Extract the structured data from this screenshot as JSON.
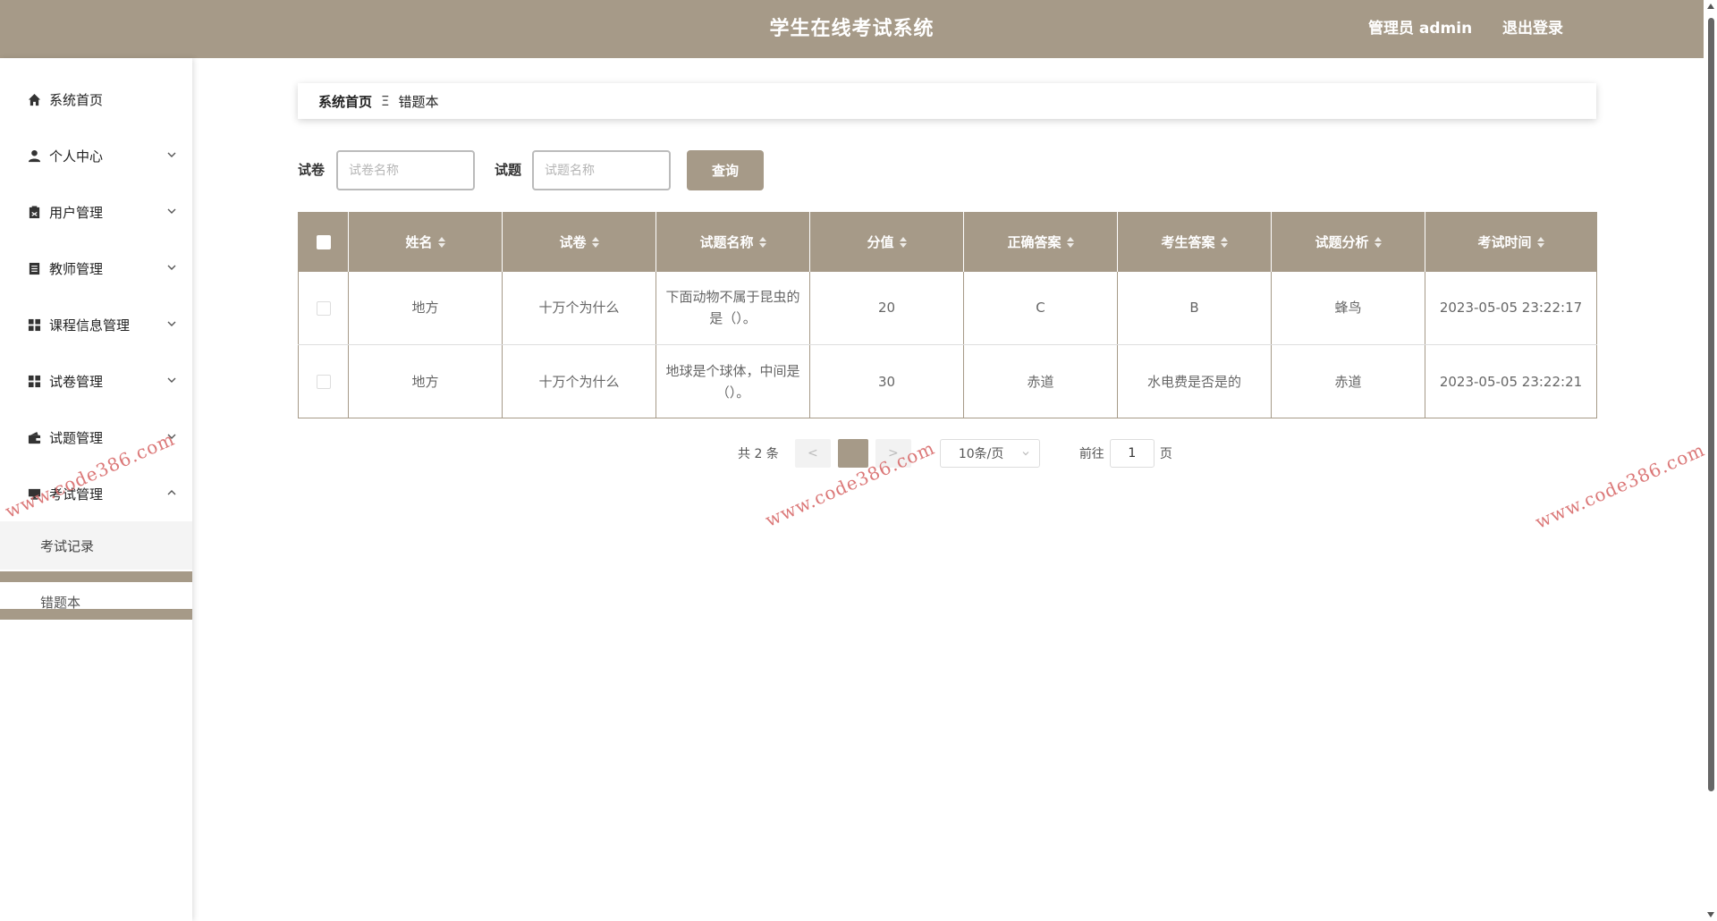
{
  "header": {
    "title": "学生在线考试系统",
    "admin_label": "管理员 admin",
    "logout_label": "退出登录"
  },
  "sidebar": {
    "items": [
      {
        "label": "系统首页",
        "icon": "home-icon",
        "expandable": false
      },
      {
        "label": "个人中心",
        "icon": "user-icon",
        "expandable": true,
        "expanded": false
      },
      {
        "label": "用户管理",
        "icon": "clipboard-icon",
        "expandable": true,
        "expanded": false
      },
      {
        "label": "教师管理",
        "icon": "document-icon",
        "expandable": true,
        "expanded": false
      },
      {
        "label": "课程信息管理",
        "icon": "grid-icon",
        "expandable": true,
        "expanded": false
      },
      {
        "label": "试卷管理",
        "icon": "grid-icon",
        "expandable": true,
        "expanded": false
      },
      {
        "label": "试题管理",
        "icon": "wallet-icon",
        "expandable": true,
        "expanded": false
      },
      {
        "label": "考试管理",
        "icon": "monitor-icon",
        "expandable": true,
        "expanded": true
      }
    ],
    "sub_items": [
      {
        "label": "考试记录"
      },
      {
        "label": "错题本"
      }
    ]
  },
  "breadcrumb": {
    "home": "系统首页",
    "separator": "Ξ",
    "current": "错题本"
  },
  "search": {
    "paper_label": "试卷",
    "paper_placeholder": "试卷名称",
    "question_label": "试题",
    "question_placeholder": "试题名称",
    "query_label": "查询"
  },
  "table": {
    "columns": [
      "姓名",
      "试卷",
      "试题名称",
      "分值",
      "正确答案",
      "考生答案",
      "试题分析",
      "考试时间"
    ],
    "rows": [
      {
        "name": "地方",
        "paper": "十万个为什么",
        "question": "下面动物不属于昆虫的是（）。",
        "score": "20",
        "correct": "C",
        "student": "B",
        "analysis": "蜂鸟",
        "time": "2023-05-05 23:22:17"
      },
      {
        "name": "地方",
        "paper": "十万个为什么",
        "question": "地球是个球体，中间是（）。",
        "score": "30",
        "correct": "赤道",
        "student": "水电费是否是的",
        "analysis": "赤道",
        "time": "2023-05-05 23:22:21"
      }
    ]
  },
  "pagination": {
    "total": "共 2 条",
    "prev": "<",
    "current_page": "1",
    "next": ">",
    "page_size": "10条/页",
    "goto_label": "前往",
    "goto_value": "1",
    "page_suffix": "页"
  },
  "watermark": "www.code386.com",
  "colors": {
    "accent": "#a69a88",
    "watermark": "#d86a6a"
  }
}
